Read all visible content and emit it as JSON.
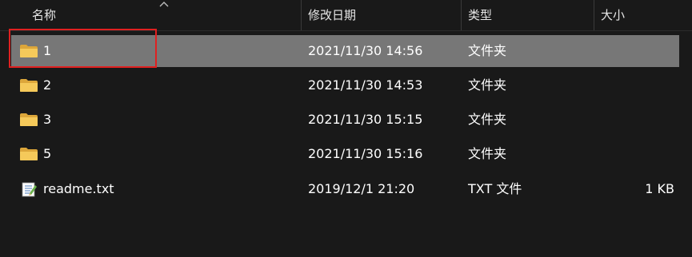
{
  "columns": {
    "name": "名称",
    "date": "修改日期",
    "type": "类型",
    "size": "大小"
  },
  "files": [
    {
      "name": "1",
      "date": "2021/11/30 14:56",
      "type": "文件夹",
      "size": "",
      "icon": "folder-icon",
      "selected": true
    },
    {
      "name": "2",
      "date": "2021/11/30 14:53",
      "type": "文件夹",
      "size": "",
      "icon": "folder-icon",
      "selected": false
    },
    {
      "name": "3",
      "date": "2021/11/30 15:15",
      "type": "文件夹",
      "size": "",
      "icon": "folder-icon",
      "selected": false
    },
    {
      "name": "5",
      "date": "2021/11/30 15:16",
      "type": "文件夹",
      "size": "",
      "icon": "folder-icon",
      "selected": false
    },
    {
      "name": "readme.txt",
      "date": "2019/12/1 21:20",
      "type": "TXT 文件",
      "size": "1 KB",
      "icon": "text-file-icon",
      "selected": false
    }
  ],
  "colors": {
    "background": "#191919",
    "selected_row": "#777777",
    "highlight_border": "#e02020",
    "folder": "#f2c14e"
  }
}
